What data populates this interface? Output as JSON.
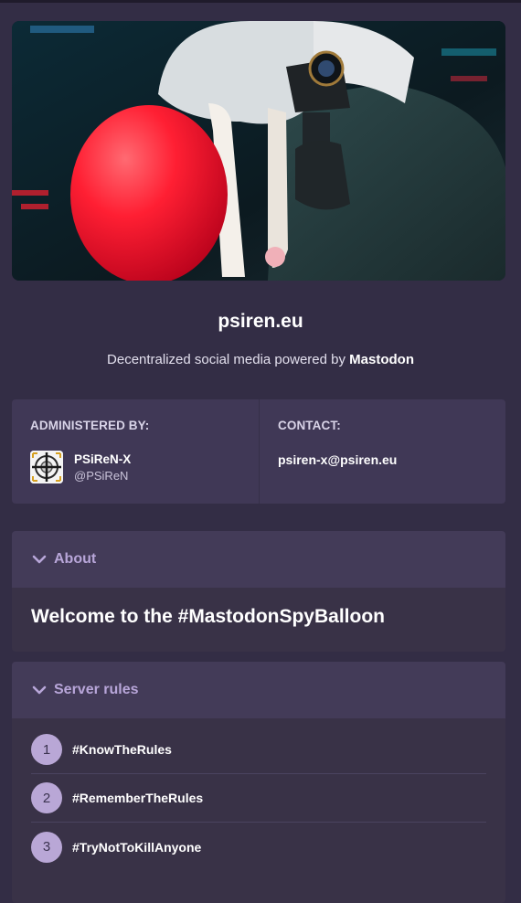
{
  "server": {
    "domain": "psiren.eu",
    "tagline_prefix": "Decentralized social media powered by ",
    "tagline_brand": "Mastodon"
  },
  "administered": {
    "heading": "ADMINISTERED BY:",
    "name": "PSiReN-X",
    "handle": "@PSiReN"
  },
  "contact": {
    "heading": "CONTACT:",
    "email": "psiren-x@psiren.eu"
  },
  "about": {
    "title": "About",
    "body": "Welcome to the #MastodonSpyBalloon"
  },
  "rules": {
    "title": "Server rules",
    "items": [
      {
        "num": "1",
        "text": "#KnowTheRules"
      },
      {
        "num": "2",
        "text": "#RememberTheRules"
      },
      {
        "num": "3",
        "text": "#TryNotToKillAnyone"
      }
    ]
  },
  "colors": {
    "background": "#332d45",
    "card": "#403856",
    "accent": "#b8a6d9",
    "balloon": "#ff2a3c"
  },
  "icons": {
    "section_toggle": "chevron-down-icon",
    "admin_avatar": "crosshair-icon"
  }
}
